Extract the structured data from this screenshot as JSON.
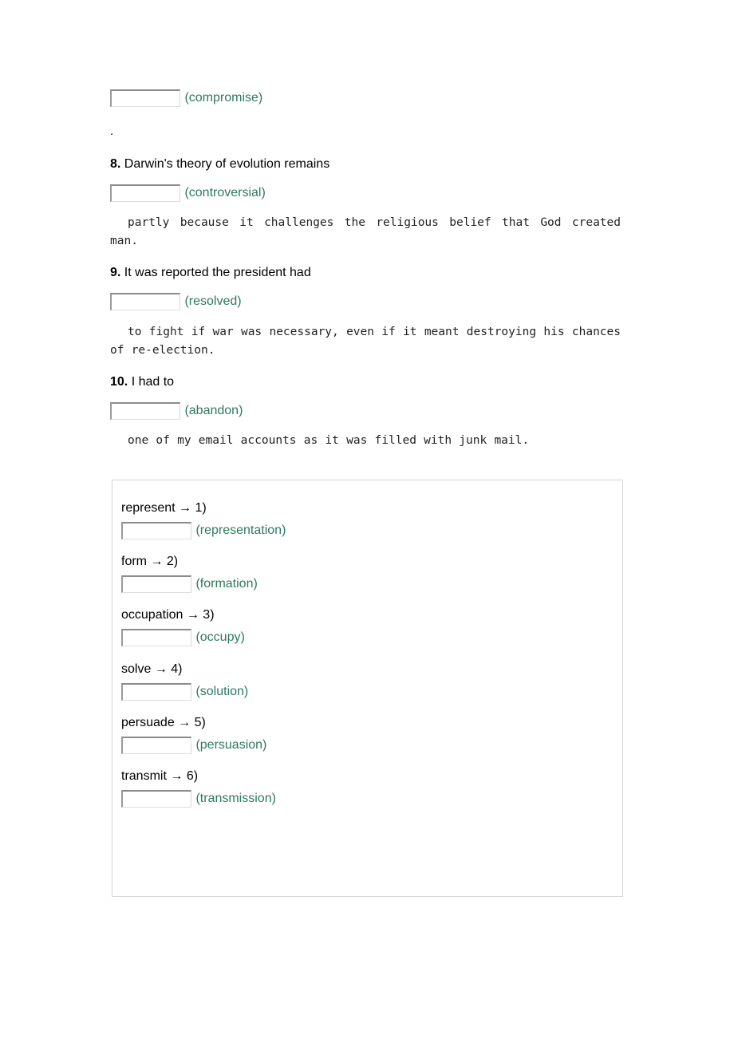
{
  "worksheet": {
    "leading_item": {
      "blank_value": "",
      "hint": "(compromise)",
      "trailing_text": "."
    },
    "questions": [
      {
        "number": "8.",
        "prompt": "Darwin's theory of evolution remains",
        "blank_value": "",
        "hint": "(controversial)",
        "sentence": "partly because it challenges the religious belief that God created man."
      },
      {
        "number": "9.",
        "prompt": "It was reported the president had",
        "blank_value": "",
        "hint": "(resolved)",
        "sentence": "to fight if war was necessary, even if it meant destroying his chances of re-election."
      },
      {
        "number": "10.",
        "prompt": "I had to",
        "blank_value": "",
        "hint": "(abandon)",
        "sentence": "one of my email accounts as it was filled with junk mail."
      }
    ],
    "word_form_panel": {
      "pairs": [
        {
          "source": "represent",
          "arrow": "→",
          "index": "1)",
          "blank_value": "",
          "hint": "(representation)"
        },
        {
          "source": "form",
          "arrow": "→",
          "index": "2)",
          "blank_value": "",
          "hint": "(formation)"
        },
        {
          "source": "occupation",
          "arrow": "→",
          "index": "3)",
          "blank_value": "",
          "hint": "(occupy)"
        },
        {
          "source": "solve",
          "arrow": "→",
          "index": "4)",
          "blank_value": "",
          "hint": "(solution)"
        },
        {
          "source": "persuade",
          "arrow": "→",
          "index": "5)",
          "blank_value": "",
          "hint": "(persuasion)"
        },
        {
          "source": "transmit",
          "arrow": "→",
          "index": "6)",
          "blank_value": "",
          "hint": "(transmission)"
        }
      ]
    }
  },
  "colors": {
    "hint_green": "#2d7a5c",
    "text_black": "#000000",
    "panel_border": "#d4d4d4",
    "input_border_dark": "#8b8b8b"
  }
}
